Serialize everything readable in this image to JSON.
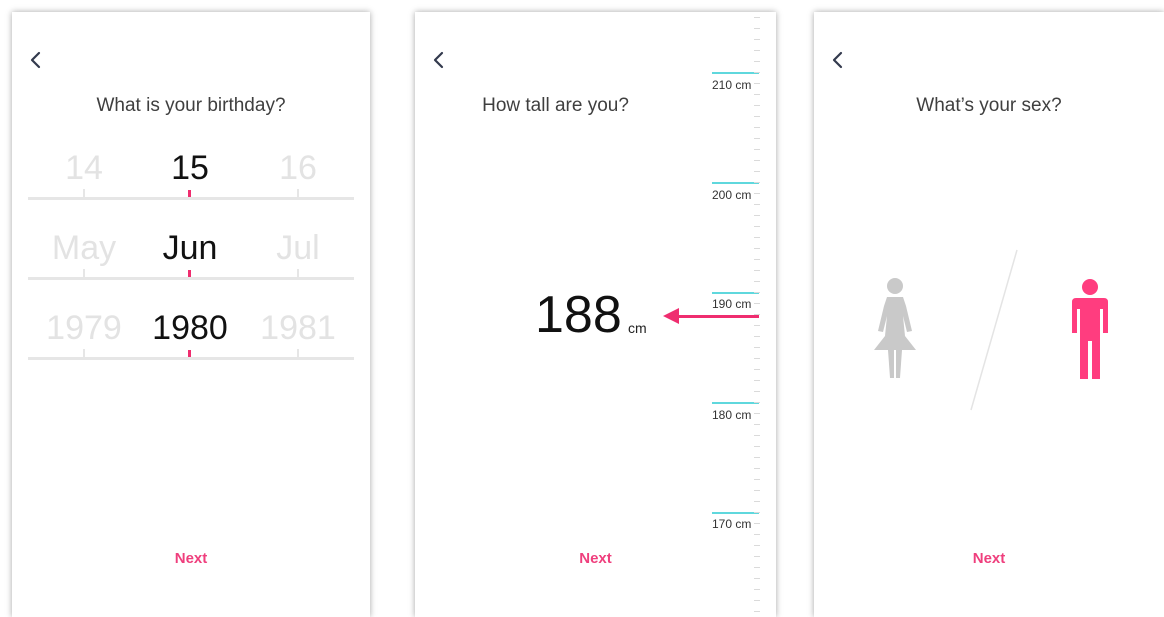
{
  "birthday_screen": {
    "title": "What is your birthday?",
    "back_icon": "chevron-left-icon",
    "day": {
      "prev": "14",
      "selected": "15",
      "next": "16"
    },
    "month": {
      "prev": "May",
      "selected": "Jun",
      "next": "Jul"
    },
    "year": {
      "prev": "1979",
      "selected": "1980",
      "next": "1981"
    },
    "next_label": "Next"
  },
  "height_screen": {
    "title": "How tall are you?",
    "back_icon": "chevron-left-icon",
    "value": "188",
    "unit": "cm",
    "ruler_labels": [
      "210 cm",
      "200 cm",
      "190 cm",
      "180 cm",
      "170 cm"
    ],
    "next_label": "Next"
  },
  "sex_screen": {
    "title": "What’s your sex?",
    "back_icon": "chevron-left-icon",
    "options": [
      "female-icon",
      "male-icon"
    ],
    "selected": "male",
    "next_label": "Next"
  },
  "colors": {
    "accent": "#ef3f7d",
    "selected_figure": "#ff3d7f",
    "unselected_figure": "#c9c9c9",
    "ruler_major": "#5fd8dd"
  }
}
